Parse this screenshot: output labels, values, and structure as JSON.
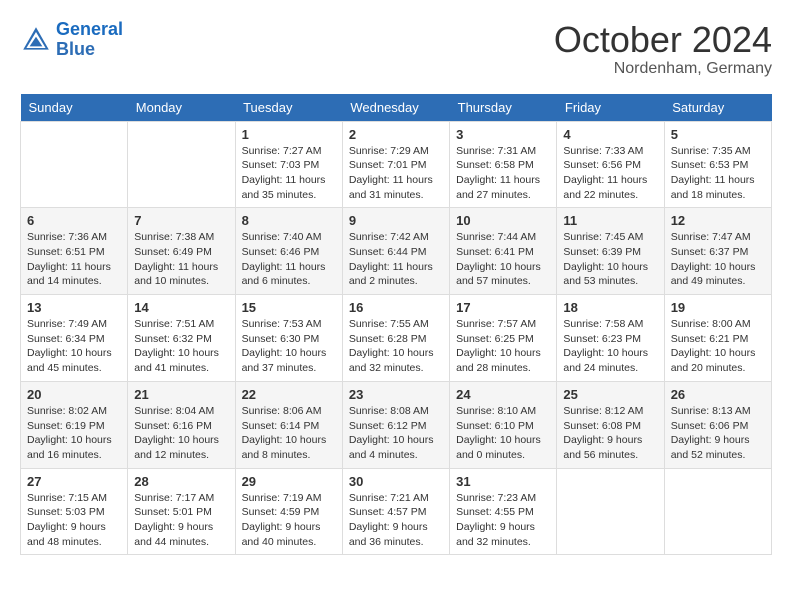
{
  "header": {
    "logo_line1": "General",
    "logo_line2": "Blue",
    "month": "October 2024",
    "location": "Nordenham, Germany"
  },
  "weekdays": [
    "Sunday",
    "Monday",
    "Tuesday",
    "Wednesday",
    "Thursday",
    "Friday",
    "Saturday"
  ],
  "weeks": [
    [
      {
        "day": "",
        "info": ""
      },
      {
        "day": "",
        "info": ""
      },
      {
        "day": "1",
        "info": "Sunrise: 7:27 AM\nSunset: 7:03 PM\nDaylight: 11 hours and 35 minutes."
      },
      {
        "day": "2",
        "info": "Sunrise: 7:29 AM\nSunset: 7:01 PM\nDaylight: 11 hours and 31 minutes."
      },
      {
        "day": "3",
        "info": "Sunrise: 7:31 AM\nSunset: 6:58 PM\nDaylight: 11 hours and 27 minutes."
      },
      {
        "day": "4",
        "info": "Sunrise: 7:33 AM\nSunset: 6:56 PM\nDaylight: 11 hours and 22 minutes."
      },
      {
        "day": "5",
        "info": "Sunrise: 7:35 AM\nSunset: 6:53 PM\nDaylight: 11 hours and 18 minutes."
      }
    ],
    [
      {
        "day": "6",
        "info": "Sunrise: 7:36 AM\nSunset: 6:51 PM\nDaylight: 11 hours and 14 minutes."
      },
      {
        "day": "7",
        "info": "Sunrise: 7:38 AM\nSunset: 6:49 PM\nDaylight: 11 hours and 10 minutes."
      },
      {
        "day": "8",
        "info": "Sunrise: 7:40 AM\nSunset: 6:46 PM\nDaylight: 11 hours and 6 minutes."
      },
      {
        "day": "9",
        "info": "Sunrise: 7:42 AM\nSunset: 6:44 PM\nDaylight: 11 hours and 2 minutes."
      },
      {
        "day": "10",
        "info": "Sunrise: 7:44 AM\nSunset: 6:41 PM\nDaylight: 10 hours and 57 minutes."
      },
      {
        "day": "11",
        "info": "Sunrise: 7:45 AM\nSunset: 6:39 PM\nDaylight: 10 hours and 53 minutes."
      },
      {
        "day": "12",
        "info": "Sunrise: 7:47 AM\nSunset: 6:37 PM\nDaylight: 10 hours and 49 minutes."
      }
    ],
    [
      {
        "day": "13",
        "info": "Sunrise: 7:49 AM\nSunset: 6:34 PM\nDaylight: 10 hours and 45 minutes."
      },
      {
        "day": "14",
        "info": "Sunrise: 7:51 AM\nSunset: 6:32 PM\nDaylight: 10 hours and 41 minutes."
      },
      {
        "day": "15",
        "info": "Sunrise: 7:53 AM\nSunset: 6:30 PM\nDaylight: 10 hours and 37 minutes."
      },
      {
        "day": "16",
        "info": "Sunrise: 7:55 AM\nSunset: 6:28 PM\nDaylight: 10 hours and 32 minutes."
      },
      {
        "day": "17",
        "info": "Sunrise: 7:57 AM\nSunset: 6:25 PM\nDaylight: 10 hours and 28 minutes."
      },
      {
        "day": "18",
        "info": "Sunrise: 7:58 AM\nSunset: 6:23 PM\nDaylight: 10 hours and 24 minutes."
      },
      {
        "day": "19",
        "info": "Sunrise: 8:00 AM\nSunset: 6:21 PM\nDaylight: 10 hours and 20 minutes."
      }
    ],
    [
      {
        "day": "20",
        "info": "Sunrise: 8:02 AM\nSunset: 6:19 PM\nDaylight: 10 hours and 16 minutes."
      },
      {
        "day": "21",
        "info": "Sunrise: 8:04 AM\nSunset: 6:16 PM\nDaylight: 10 hours and 12 minutes."
      },
      {
        "day": "22",
        "info": "Sunrise: 8:06 AM\nSunset: 6:14 PM\nDaylight: 10 hours and 8 minutes."
      },
      {
        "day": "23",
        "info": "Sunrise: 8:08 AM\nSunset: 6:12 PM\nDaylight: 10 hours and 4 minutes."
      },
      {
        "day": "24",
        "info": "Sunrise: 8:10 AM\nSunset: 6:10 PM\nDaylight: 10 hours and 0 minutes."
      },
      {
        "day": "25",
        "info": "Sunrise: 8:12 AM\nSunset: 6:08 PM\nDaylight: 9 hours and 56 minutes."
      },
      {
        "day": "26",
        "info": "Sunrise: 8:13 AM\nSunset: 6:06 PM\nDaylight: 9 hours and 52 minutes."
      }
    ],
    [
      {
        "day": "27",
        "info": "Sunrise: 7:15 AM\nSunset: 5:03 PM\nDaylight: 9 hours and 48 minutes."
      },
      {
        "day": "28",
        "info": "Sunrise: 7:17 AM\nSunset: 5:01 PM\nDaylight: 9 hours and 44 minutes."
      },
      {
        "day": "29",
        "info": "Sunrise: 7:19 AM\nSunset: 4:59 PM\nDaylight: 9 hours and 40 minutes."
      },
      {
        "day": "30",
        "info": "Sunrise: 7:21 AM\nSunset: 4:57 PM\nDaylight: 9 hours and 36 minutes."
      },
      {
        "day": "31",
        "info": "Sunrise: 7:23 AM\nSunset: 4:55 PM\nDaylight: 9 hours and 32 minutes."
      },
      {
        "day": "",
        "info": ""
      },
      {
        "day": "",
        "info": ""
      }
    ]
  ]
}
